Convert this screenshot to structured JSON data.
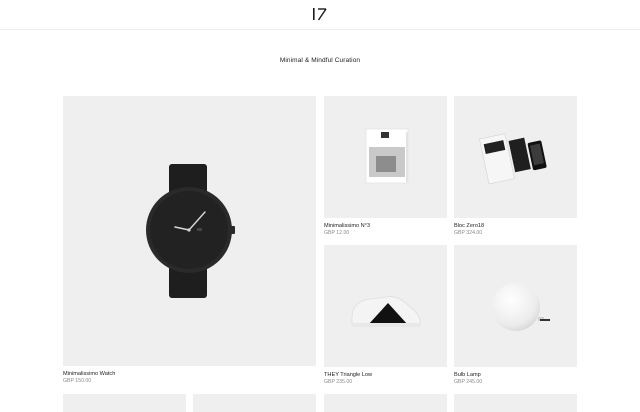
{
  "brand": {
    "logo_icon": "iz-logo-icon"
  },
  "tagline": "Minimal & Mindful Curation",
  "products": [
    {
      "id": "watch",
      "name": "Minimalissimo Watch",
      "price": "GBP 150.00",
      "icon": "watch-icon"
    },
    {
      "id": "magazine",
      "name": "Minimalissimo N°3",
      "price": "GBP 12.00",
      "icon": "magazine-icon"
    },
    {
      "id": "zero18",
      "name": "Bloc Zero18",
      "price": "GBP 324.00",
      "icon": "notebook-set-icon"
    },
    {
      "id": "sneaker",
      "name": "THEY Triangle Low",
      "price": "GBP 235.00",
      "icon": "sneaker-icon"
    },
    {
      "id": "lamp",
      "name": "Bulb Lamp",
      "price": "GBP 245.00",
      "icon": "lamp-icon"
    }
  ],
  "colors": {
    "tile_bg": "#efefef",
    "price_gray": "#8a8a8a",
    "text": "#222222"
  }
}
